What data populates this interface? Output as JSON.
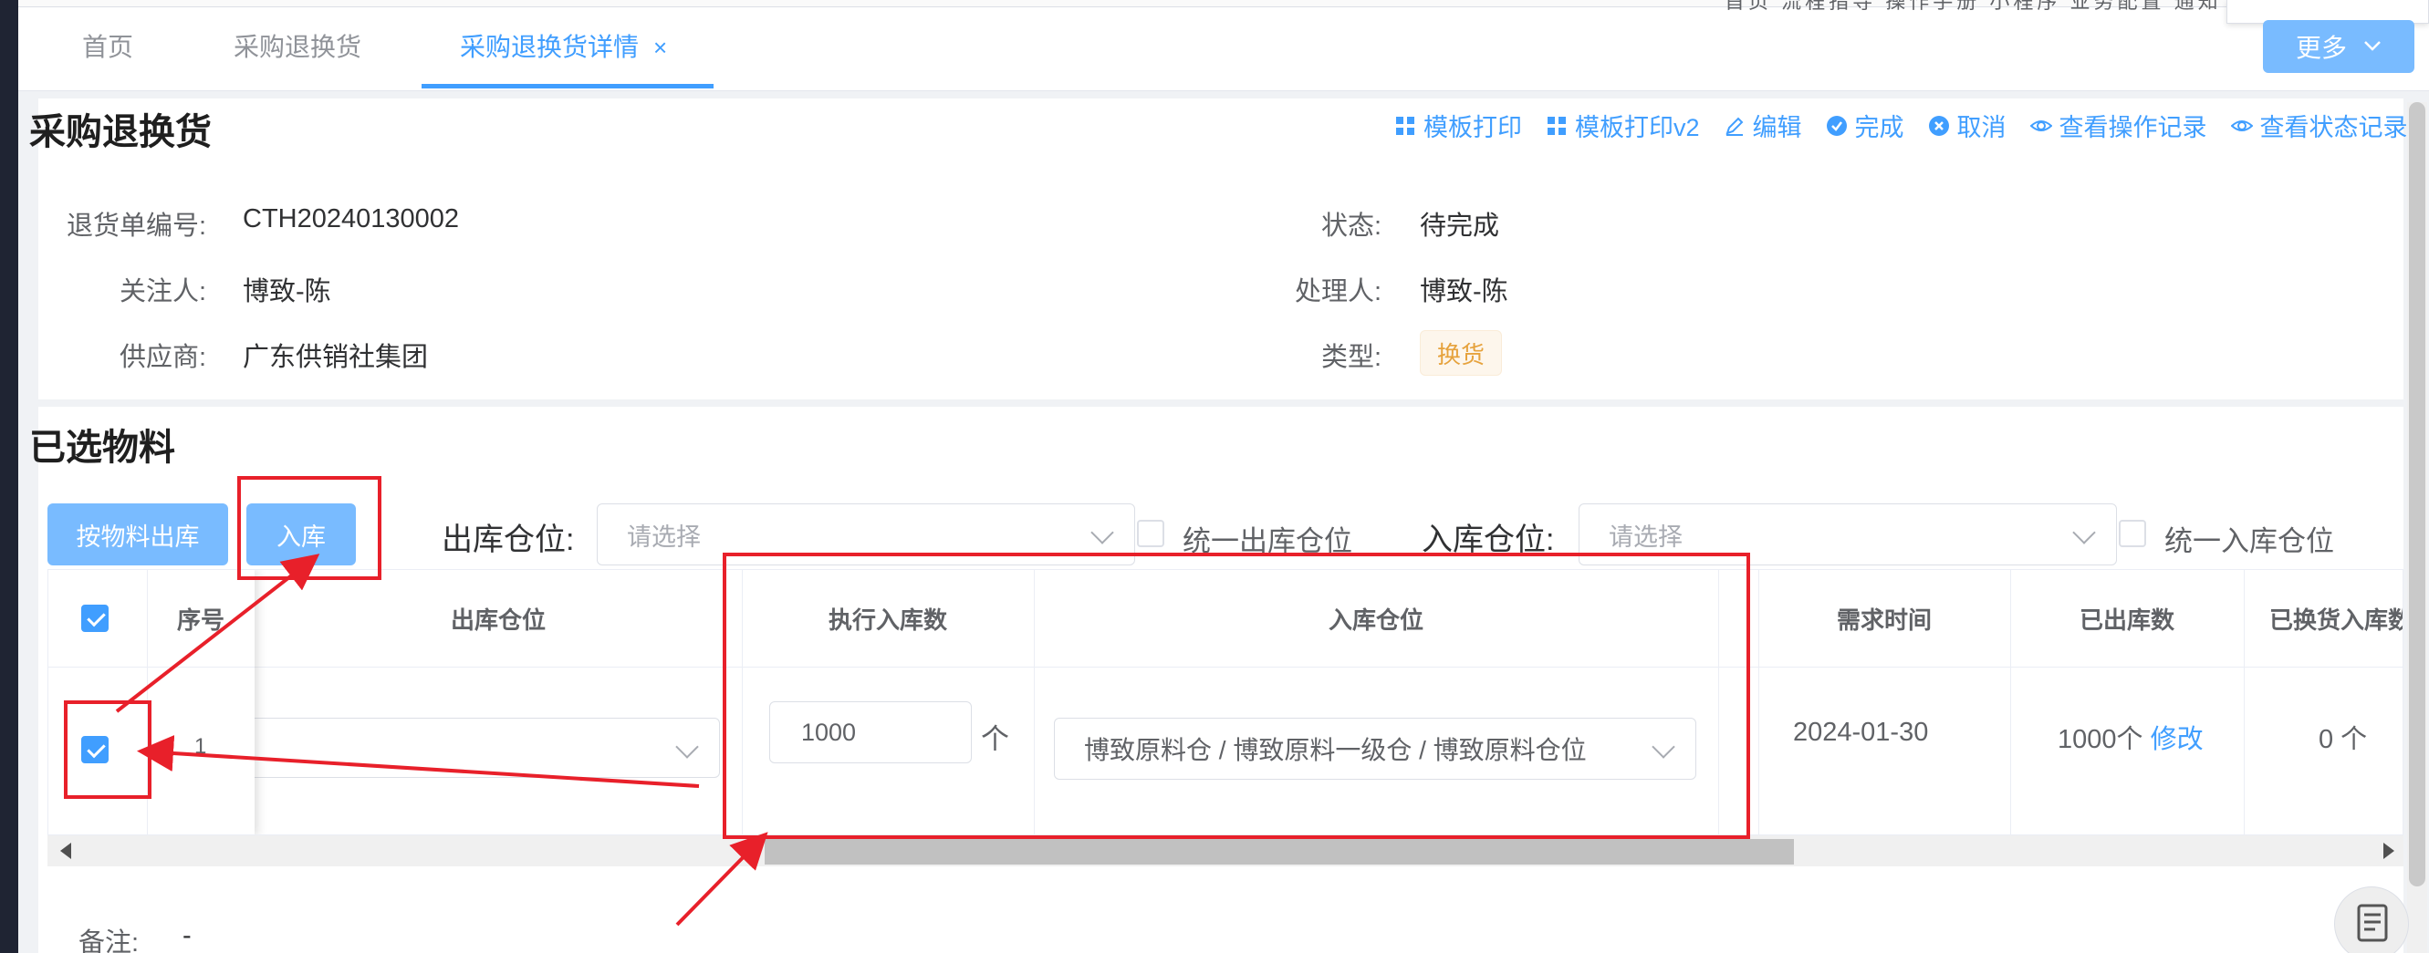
{
  "tabs": [
    {
      "label": "首页"
    },
    {
      "label": "采购退换货"
    },
    {
      "label": "采购退换货详情",
      "close": "×"
    }
  ],
  "header": {
    "top_links": "首页 流程指导 操作手册 小程序 业务配置 通知",
    "more_label": "更多"
  },
  "detail": {
    "title": "采购退换货",
    "actions": [
      "模板打印",
      "模板打印v2",
      "编辑",
      "完成",
      "取消",
      "查看操作记录",
      "查看状态记录"
    ],
    "fields": {
      "return_no_label": "退货单编号:",
      "return_no": "CTH20240130002",
      "follower_label": "关注人:",
      "follower": "博致-陈",
      "supplier_label": "供应商:",
      "supplier": "广东供销社集团",
      "status_label": "状态:",
      "status": "待完成",
      "handler_label": "处理人:",
      "handler": "博致-陈",
      "type_label": "类型:",
      "type": "换货"
    }
  },
  "materials": {
    "title": "已选物料",
    "btn_out": "按物料出库",
    "btn_in": "入库",
    "out_wh_label": "出库仓位:",
    "out_wh_placeholder": "请选择",
    "unify_out_label": "统一出库仓位",
    "in_wh_label": "入库仓位:",
    "in_wh_placeholder": "请选择",
    "unify_in_label": "统一入库仓位",
    "columns": [
      "序号",
      "出库仓位",
      "执行入库数",
      "入库仓位",
      "需求时间",
      "已出库数",
      "已换货入库数"
    ],
    "rows": [
      {
        "index": "1",
        "in_qty": "1000",
        "unit": "个",
        "in_wh": "博致原料仓 / 博致原料一级仓 / 博致原料仓位",
        "need_date": "2024-01-30",
        "out_qty": "1000个",
        "modify": "修改",
        "exchange_in": "0 个"
      }
    ]
  },
  "remark": {
    "label": "备注:",
    "value": "-"
  },
  "colors": {
    "accent": "#409eff",
    "button": "#79bbff",
    "annotation": "#e8202a",
    "tag_text": "#e6a23c"
  }
}
